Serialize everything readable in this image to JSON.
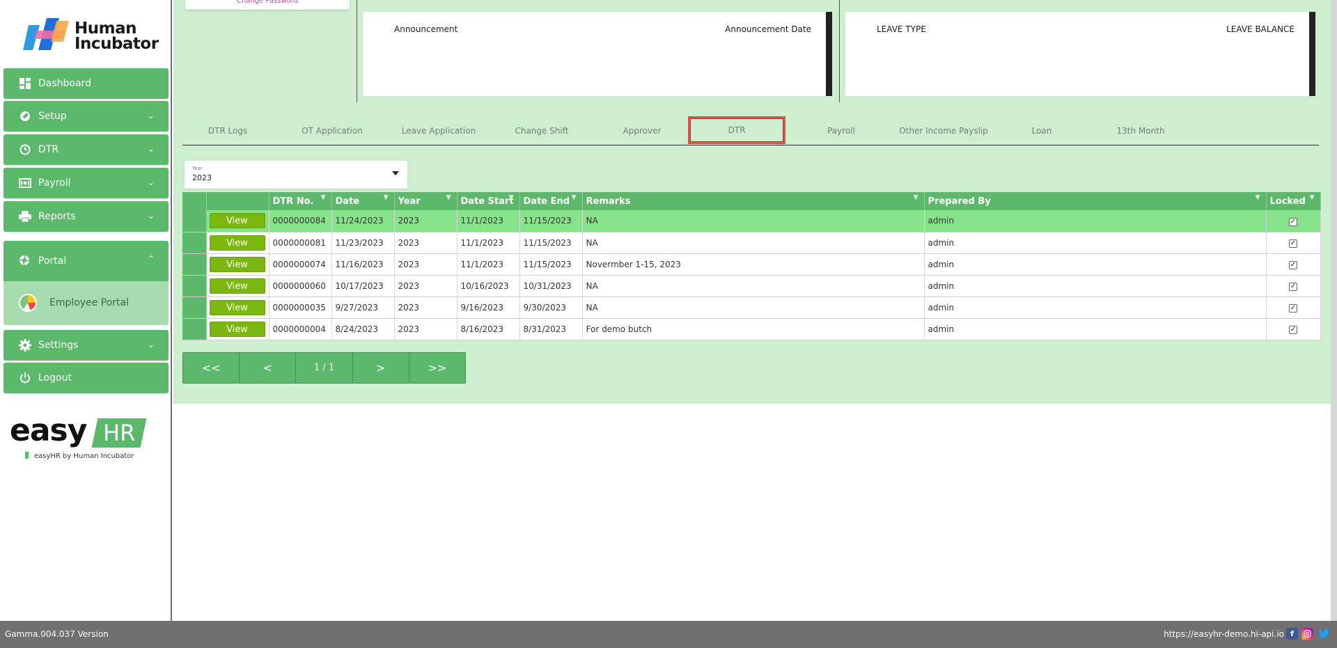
{
  "sidebar": {
    "logo_text_line1": "Human",
    "logo_text_line2": "Incubator",
    "items": [
      {
        "label": "Dashboard",
        "icon": "dashboard-icon"
      },
      {
        "label": "Setup",
        "icon": "wrench-icon"
      },
      {
        "label": "DTR",
        "icon": "clock-icon"
      },
      {
        "label": "Payroll",
        "icon": "money-icon"
      },
      {
        "label": "Reports",
        "icon": "printer-icon"
      },
      {
        "label": "Portal",
        "icon": "portal-icon"
      },
      {
        "label": "Settings",
        "icon": "gear-icon"
      },
      {
        "label": "Logout",
        "icon": "power-icon"
      }
    ],
    "portal_sub": {
      "label": "Employee Portal"
    },
    "brand": {
      "easy": "easy",
      "hr": "HR",
      "tagline": "easyHR by Human Incubator"
    }
  },
  "header": {
    "change_password": "Change Password",
    "announcement_card": {
      "col1": "Announcement",
      "col2": "Announcement Date"
    },
    "leave_card": {
      "col1": "LEAVE TYPE",
      "col2": "LEAVE BALANCE"
    }
  },
  "tabs": [
    {
      "label": "DTR Logs"
    },
    {
      "label": "OT Application"
    },
    {
      "label": "Leave Application"
    },
    {
      "label": "Change Shift"
    },
    {
      "label": "Approver"
    },
    {
      "label": "DTR"
    },
    {
      "label": "Payroll"
    },
    {
      "label": "Other Income Payslip"
    },
    {
      "label": "Loan"
    },
    {
      "label": "13th Month"
    }
  ],
  "year_filter": {
    "label": "Year",
    "value": "2023"
  },
  "table": {
    "columns": [
      "DTR No.",
      "Date",
      "Year",
      "Date Start",
      "Date End",
      "Remarks",
      "Prepared By",
      "Locked"
    ],
    "view_label": "View",
    "rows": [
      {
        "dtr_no": "0000000084",
        "date": "11/24/2023",
        "year": "2023",
        "start": "11/1/2023",
        "end": "11/15/2023",
        "remarks": "NA",
        "prepared": "admin",
        "locked": "✓"
      },
      {
        "dtr_no": "0000000081",
        "date": "11/23/2023",
        "year": "2023",
        "start": "11/1/2023",
        "end": "11/15/2023",
        "remarks": "NA",
        "prepared": "admin",
        "locked": "✓"
      },
      {
        "dtr_no": "0000000074",
        "date": "11/16/2023",
        "year": "2023",
        "start": "11/1/2023",
        "end": "11/15/2023",
        "remarks": "Novermber 1-15, 2023",
        "prepared": "admin",
        "locked": "✓"
      },
      {
        "dtr_no": "0000000060",
        "date": "10/17/2023",
        "year": "2023",
        "start": "10/16/2023",
        "end": "10/31/2023",
        "remarks": "NA",
        "prepared": "admin",
        "locked": "✓"
      },
      {
        "dtr_no": "0000000035",
        "date": "9/27/2023",
        "year": "2023",
        "start": "9/16/2023",
        "end": "9/30/2023",
        "remarks": "NA",
        "prepared": "admin",
        "locked": "✓"
      },
      {
        "dtr_no": "0000000004",
        "date": "8/24/2023",
        "year": "2023",
        "start": "8/16/2023",
        "end": "8/31/2023",
        "remarks": "For demo butch",
        "prepared": "admin",
        "locked": "✓"
      }
    ]
  },
  "pager": {
    "first": "<<",
    "prev": "<",
    "info": "1 / 1",
    "next": ">",
    "last": ">>"
  },
  "footer": {
    "version": "Gamma.004.037 Version",
    "url": "https://easyhr-demo.hi-api.io"
  },
  "colors": {
    "accent": "#5cb96c",
    "selected_row": "#87e38a",
    "view_button": "#7cb70f",
    "active_tab_border": "#d9534f"
  }
}
